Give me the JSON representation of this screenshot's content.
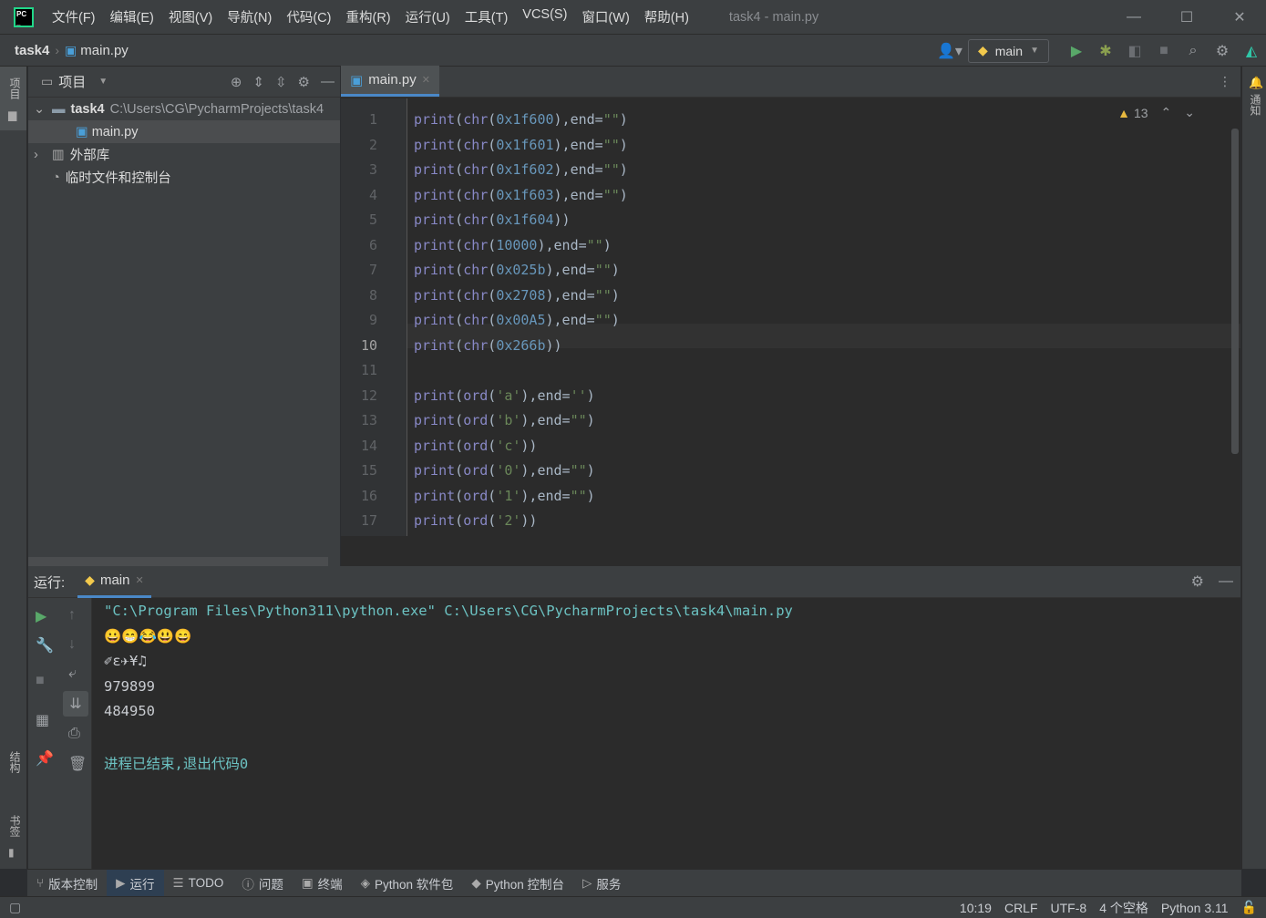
{
  "titlebar": {
    "menu": [
      "文件(F)",
      "编辑(E)",
      "视图(V)",
      "导航(N)",
      "代码(C)",
      "重构(R)",
      "运行(U)",
      "工具(T)",
      "VCS(S)",
      "窗口(W)",
      "帮助(H)"
    ],
    "title": "task4 - main.py"
  },
  "navbar": {
    "project": "task4",
    "file": "main.py",
    "run_config": "main"
  },
  "left_strip": {
    "project": "项目",
    "structure": "结构",
    "bookmarks": "书签"
  },
  "right_strip": {
    "notifications": "通知"
  },
  "project_panel": {
    "title": "项目",
    "root_name": "task4",
    "root_path": "C:\\Users\\CG\\PycharmProjects\\task4",
    "file": "main.py",
    "external_libs": "外部库",
    "scratches": "临时文件和控制台"
  },
  "editor": {
    "tab": "main.py",
    "warnings": "13",
    "current_line": 10,
    "lines": [
      [
        [
          "print",
          "fn"
        ],
        [
          "(",
          ""
        ],
        [
          "chr",
          "fn"
        ],
        [
          "(",
          ""
        ],
        [
          "0x1f600",
          "num"
        ],
        [
          "),end=",
          ""
        ],
        [
          "\"\"",
          "str"
        ],
        [
          ")",
          ""
        ]
      ],
      [
        [
          "print",
          "fn"
        ],
        [
          "(",
          ""
        ],
        [
          "chr",
          "fn"
        ],
        [
          "(",
          ""
        ],
        [
          "0x1f601",
          "num"
        ],
        [
          "),end=",
          ""
        ],
        [
          "\"\"",
          "str"
        ],
        [
          ")",
          ""
        ]
      ],
      [
        [
          "print",
          "fn"
        ],
        [
          "(",
          ""
        ],
        [
          "chr",
          "fn"
        ],
        [
          "(",
          ""
        ],
        [
          "0x1f602",
          "num"
        ],
        [
          "),end=",
          ""
        ],
        [
          "\"\"",
          "str"
        ],
        [
          ")",
          ""
        ]
      ],
      [
        [
          "print",
          "fn"
        ],
        [
          "(",
          ""
        ],
        [
          "chr",
          "fn"
        ],
        [
          "(",
          ""
        ],
        [
          "0x1f603",
          "num"
        ],
        [
          "),end=",
          ""
        ],
        [
          "\"\"",
          "str"
        ],
        [
          ")",
          ""
        ]
      ],
      [
        [
          "print",
          "fn"
        ],
        [
          "(",
          ""
        ],
        [
          "chr",
          "fn"
        ],
        [
          "(",
          ""
        ],
        [
          "0x1f604",
          "num"
        ],
        [
          "))",
          ""
        ]
      ],
      [
        [
          "print",
          "fn"
        ],
        [
          "(",
          ""
        ],
        [
          "chr",
          "fn"
        ],
        [
          "(",
          ""
        ],
        [
          "10000",
          "num"
        ],
        [
          "),end=",
          ""
        ],
        [
          "\"\"",
          "str"
        ],
        [
          ")",
          ""
        ]
      ],
      [
        [
          "print",
          "fn"
        ],
        [
          "(",
          ""
        ],
        [
          "chr",
          "fn"
        ],
        [
          "(",
          ""
        ],
        [
          "0x025b",
          "num"
        ],
        [
          "),end=",
          ""
        ],
        [
          "\"\"",
          "str"
        ],
        [
          ")",
          ""
        ]
      ],
      [
        [
          "print",
          "fn"
        ],
        [
          "(",
          ""
        ],
        [
          "chr",
          "fn"
        ],
        [
          "(",
          ""
        ],
        [
          "0x2708",
          "num"
        ],
        [
          "),end=",
          ""
        ],
        [
          "\"\"",
          "str"
        ],
        [
          ")",
          ""
        ]
      ],
      [
        [
          "print",
          "fn"
        ],
        [
          "(",
          ""
        ],
        [
          "chr",
          "fn"
        ],
        [
          "(",
          ""
        ],
        [
          "0x00A5",
          "num"
        ],
        [
          "),end=",
          ""
        ],
        [
          "\"\"",
          "str"
        ],
        [
          ")",
          ""
        ]
      ],
      [
        [
          "print",
          "fn"
        ],
        [
          "(",
          ""
        ],
        [
          "chr",
          "fn"
        ],
        [
          "(",
          ""
        ],
        [
          "0x266b",
          "num"
        ],
        [
          "))",
          ""
        ]
      ],
      [],
      [
        [
          "print",
          "fn"
        ],
        [
          "(",
          ""
        ],
        [
          "ord",
          "fn"
        ],
        [
          "(",
          ""
        ],
        [
          "'a'",
          "str"
        ],
        [
          "),end=",
          ""
        ],
        [
          "''",
          "str"
        ],
        [
          ")",
          ""
        ]
      ],
      [
        [
          "print",
          "fn"
        ],
        [
          "(",
          ""
        ],
        [
          "ord",
          "fn"
        ],
        [
          "(",
          ""
        ],
        [
          "'b'",
          "str"
        ],
        [
          "),end=",
          ""
        ],
        [
          "\"\"",
          "str"
        ],
        [
          ")",
          ""
        ]
      ],
      [
        [
          "print",
          "fn"
        ],
        [
          "(",
          ""
        ],
        [
          "ord",
          "fn"
        ],
        [
          "(",
          ""
        ],
        [
          "'c'",
          "str"
        ],
        [
          "))",
          ""
        ]
      ],
      [
        [
          "print",
          "fn"
        ],
        [
          "(",
          ""
        ],
        [
          "ord",
          "fn"
        ],
        [
          "(",
          ""
        ],
        [
          "'0'",
          "str"
        ],
        [
          "),end=",
          ""
        ],
        [
          "\"\"",
          "str"
        ],
        [
          ")",
          ""
        ]
      ],
      [
        [
          "print",
          "fn"
        ],
        [
          "(",
          ""
        ],
        [
          "ord",
          "fn"
        ],
        [
          "(",
          ""
        ],
        [
          "'1'",
          "str"
        ],
        [
          "),end=",
          ""
        ],
        [
          "\"\"",
          "str"
        ],
        [
          ")",
          ""
        ]
      ],
      [
        [
          "print",
          "fn"
        ],
        [
          "(",
          ""
        ],
        [
          "ord",
          "fn"
        ],
        [
          "(",
          ""
        ],
        [
          "'2'",
          "str"
        ],
        [
          "))",
          ""
        ]
      ]
    ]
  },
  "run_panel": {
    "label": "运行:",
    "tab": "main",
    "output": [
      {
        "text": "\"C:\\Program Files\\Python311\\python.exe\" C:\\Users\\CG\\PycharmProjects\\task4\\main.py",
        "color": "#6cc2c2"
      },
      {
        "text": "😀😁😂😃😄",
        "color": "#c9ccd1"
      },
      {
        "text": "✐ɛ✈¥♫",
        "color": "#c9ccd1"
      },
      {
        "text": "979899",
        "color": "#c9ccd1"
      },
      {
        "text": "484950",
        "color": "#c9ccd1"
      },
      {
        "text": "",
        "color": "#c9ccd1"
      },
      {
        "text": "进程已结束,退出代码0",
        "color": "#6cc2c2"
      }
    ]
  },
  "bottom_tabs": [
    "版本控制",
    "运行",
    "TODO",
    "问题",
    "终端",
    "Python 软件包",
    "Python 控制台",
    "服务"
  ],
  "statusbar": {
    "position": "10:19",
    "line_sep": "CRLF",
    "encoding": "UTF-8",
    "indent": "4 个空格",
    "interpreter": "Python 3.11"
  }
}
